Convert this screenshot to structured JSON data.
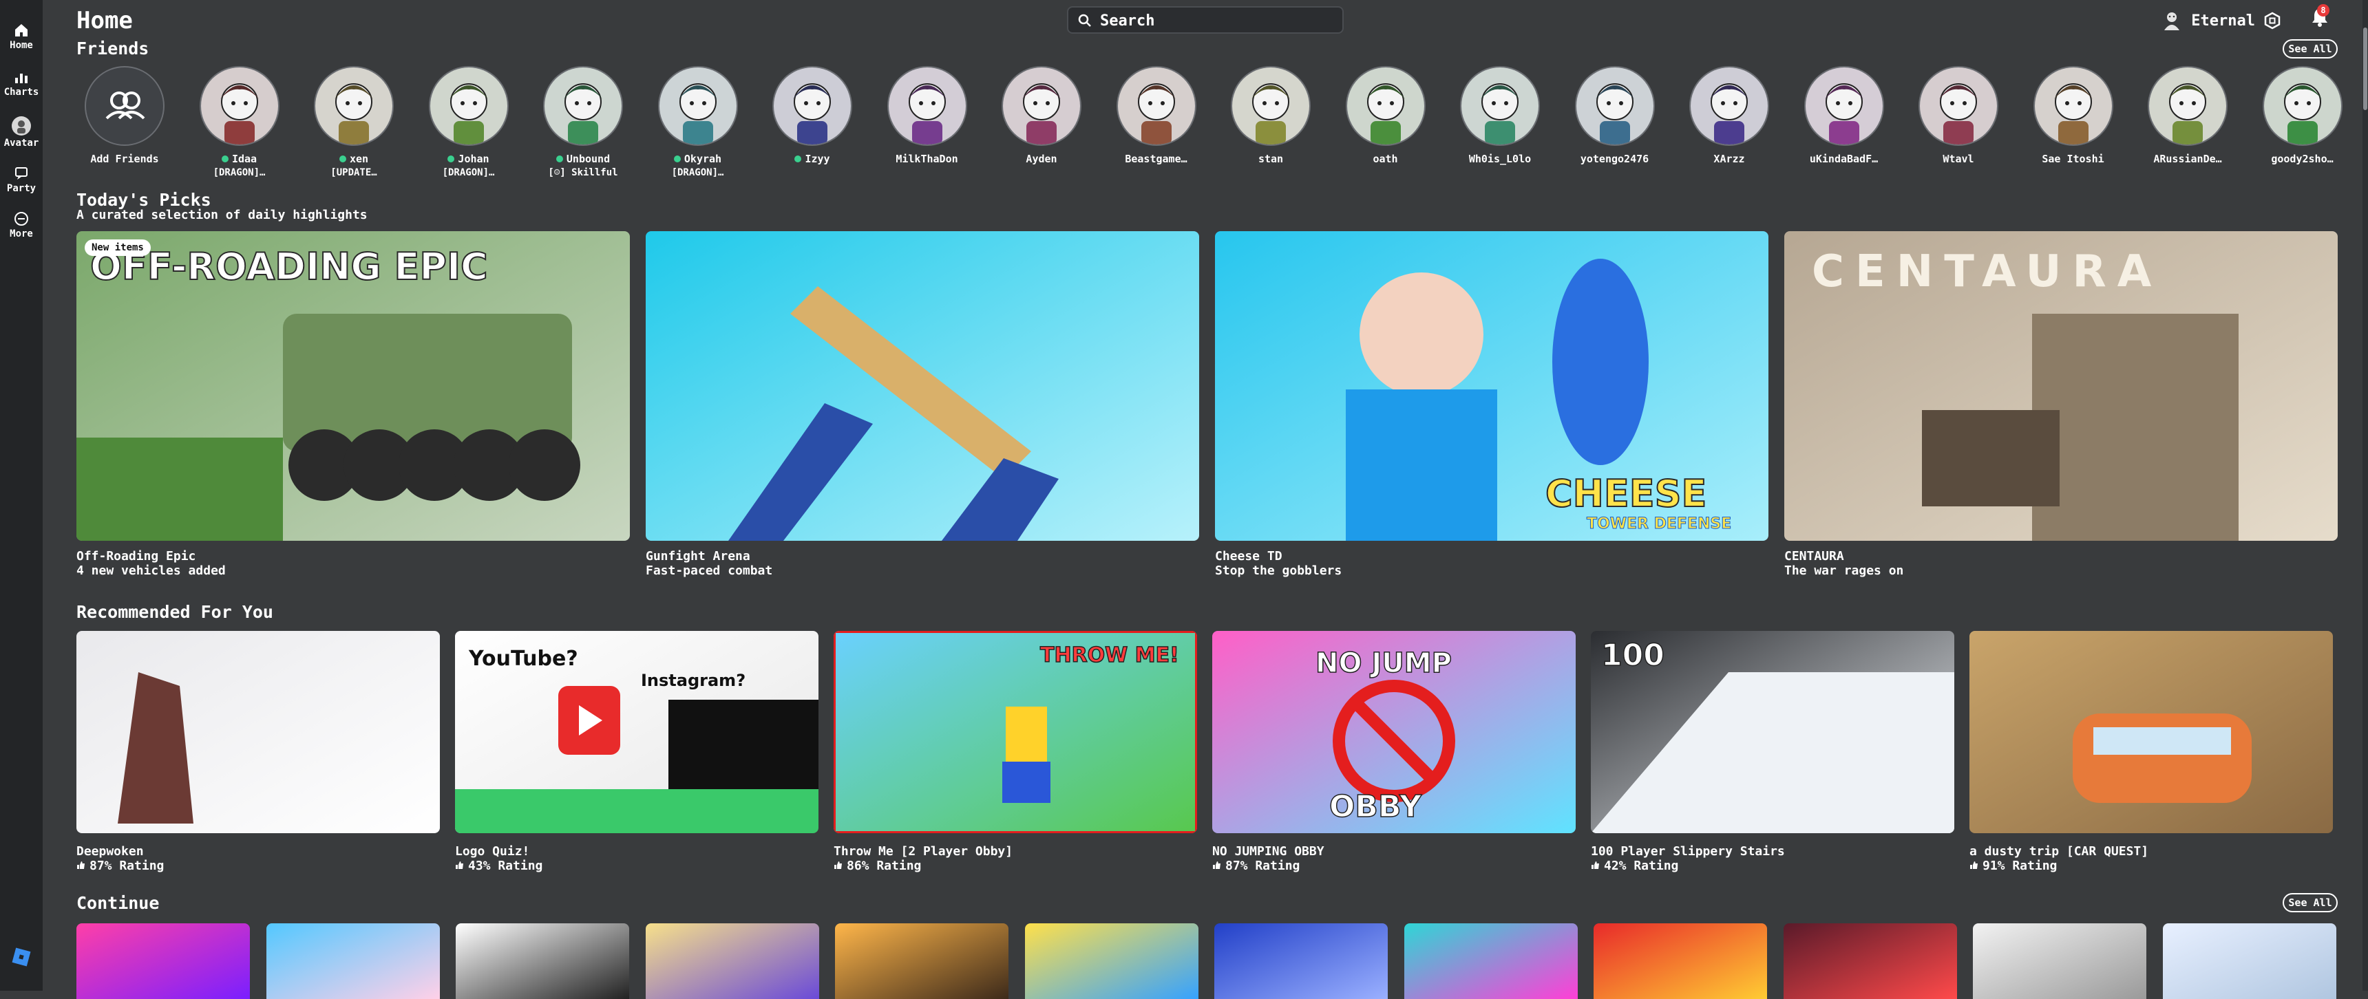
{
  "nav": [
    {
      "label": "Home",
      "icon": "home-icon"
    },
    {
      "label": "Charts",
      "icon": "charts-icon"
    },
    {
      "label": "Avatar",
      "icon": "avatar-icon"
    },
    {
      "label": "Party",
      "icon": "party-icon"
    },
    {
      "label": "More",
      "icon": "more-icon"
    }
  ],
  "page_title": "Home",
  "search": {
    "placeholder": "Search"
  },
  "user": {
    "name": "Eternal",
    "notification_count": "8"
  },
  "friends_section": {
    "title": "Friends",
    "see_all": "See All",
    "add_label": "Add Friends"
  },
  "friends": [
    {
      "name": "Idaa",
      "status": "[DRAGON]…",
      "online": true
    },
    {
      "name": "xen",
      "status": "[UPDATE…",
      "online": true
    },
    {
      "name": "Johan",
      "status": "[DRAGON]…",
      "online": true
    },
    {
      "name": "Unbound",
      "status": "[☺] Skillful",
      "online": true
    },
    {
      "name": "Okyrah",
      "status": "[DRAGON]…",
      "online": true
    },
    {
      "name": "Izyy",
      "status": "",
      "online": true
    },
    {
      "name": "MilkThaDon",
      "status": "",
      "online": false
    },
    {
      "name": "Ayden",
      "status": "",
      "online": false
    },
    {
      "name": "Beastgame…",
      "status": "",
      "online": false
    },
    {
      "name": "stan",
      "status": "",
      "online": false
    },
    {
      "name": "oath",
      "status": "",
      "online": false
    },
    {
      "name": "Wh0is_L0lo",
      "status": "",
      "online": false
    },
    {
      "name": "yotengo2476",
      "status": "",
      "online": false
    },
    {
      "name": "XArzz",
      "status": "",
      "online": false
    },
    {
      "name": "uKindaBadF…",
      "status": "",
      "online": false
    },
    {
      "name": "Wtavl",
      "status": "",
      "online": false
    },
    {
      "name": "Sae Itoshi",
      "status": "",
      "online": false
    },
    {
      "name": "ARussianDe…",
      "status": "",
      "online": false
    },
    {
      "name": "goody2sho…",
      "status": "",
      "online": false
    }
  ],
  "picks_section": {
    "title": "Today's Picks",
    "subtitle": "A curated selection of daily highlights"
  },
  "picks": [
    {
      "title": "Off-Roading Epic",
      "subtitle": "4 new vehicles added",
      "badge": "New items",
      "art_text": "OFF-ROADING EPIC",
      "colors": [
        "#7ba86b",
        "#c8d6c0"
      ]
    },
    {
      "title": "Gunfight Arena",
      "subtitle": "Fast-paced combat",
      "art_text": "",
      "colors": [
        "#1fc9ea",
        "#b7f1fb"
      ]
    },
    {
      "title": "Cheese TD",
      "subtitle": "Stop the gobblers",
      "art_text": "CHEESE",
      "art_sub": "TOWER DEFENSE",
      "colors": [
        "#27c6ee",
        "#a8eefb"
      ]
    },
    {
      "title": "CENTAURA",
      "subtitle": "The war rages on",
      "art_text": "CENTAURA",
      "colors": [
        "#b6a793",
        "#e6dccb"
      ]
    }
  ],
  "recommended_section": {
    "title": "Recommended For You"
  },
  "recommended": [
    {
      "title": "Deepwoken",
      "rating": "87% Rating",
      "art_text": "",
      "colors": [
        "#e9e9ec",
        "#ffffff"
      ]
    },
    {
      "title": "Logo Quiz!",
      "rating": "43% Rating",
      "art_text": "YouTube?",
      "art_sub": "Instagram?",
      "colors": [
        "#ffffff",
        "#e7e7e7"
      ]
    },
    {
      "title": "Throw Me [2 Player Obby]",
      "rating": "86% Rating",
      "art_text": "THROW ME!",
      "colors": [
        "#6ad1ff",
        "#58c84d"
      ]
    },
    {
      "title": "NO JUMPING OBBY",
      "rating": "87% Rating",
      "art_text": "NO JUMP",
      "art_sub": "OBBY",
      "colors": [
        "#ff5fc7",
        "#5fe3ff"
      ]
    },
    {
      "title": "100 Player Slippery Stairs",
      "rating": "42% Rating",
      "art_text": "100",
      "colors": [
        "#2b2d31",
        "#eef2f6"
      ]
    },
    {
      "title": "a dusty trip [CAR QUEST]",
      "rating": "91% Rating",
      "art_text": "",
      "colors": [
        "#c9a46a",
        "#8a6a44"
      ]
    }
  ],
  "continue_section": {
    "title": "Continue",
    "see_all": "See All"
  },
  "continue_tiles": [
    {
      "colors": [
        "#ff3fa8",
        "#7a1fff"
      ]
    },
    {
      "colors": [
        "#53c8ff",
        "#ffd0e8"
      ]
    },
    {
      "colors": [
        "#ffffff",
        "#222222"
      ]
    },
    {
      "colors": [
        "#f7e08a",
        "#6a4ad8"
      ]
    },
    {
      "colors": [
        "#ffb64a",
        "#3d2a1a"
      ]
    },
    {
      "colors": [
        "#ffe04a",
        "#36a2ff"
      ]
    },
    {
      "colors": [
        "#2240c8",
        "#9ab0ff"
      ]
    },
    {
      "colors": [
        "#2ed6d6",
        "#ff3fd6"
      ]
    },
    {
      "colors": [
        "#e82a2a",
        "#ffcc33"
      ]
    },
    {
      "colors": [
        "#5a1a2a",
        "#ff4a4a"
      ]
    },
    {
      "colors": [
        "#f2f2f2",
        "#9a9a9a"
      ]
    },
    {
      "colors": [
        "#e8f0ff",
        "#b0c6e0"
      ]
    }
  ]
}
